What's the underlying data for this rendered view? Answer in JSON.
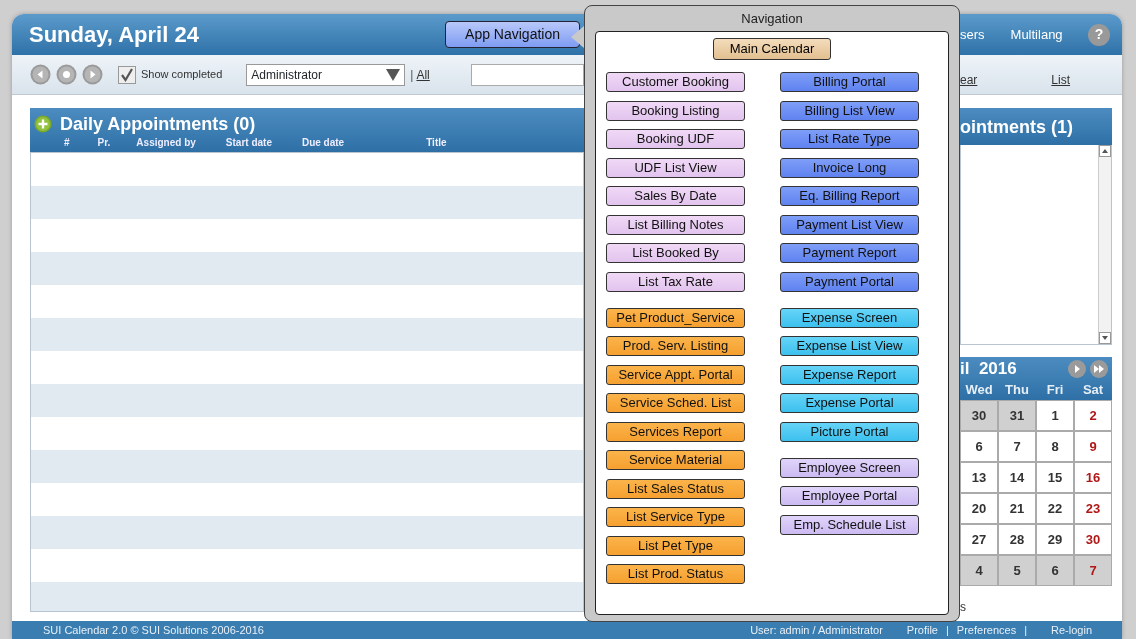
{
  "header": {
    "title": "Sunday, April 24",
    "nav_button": "App Navigation",
    "links": [
      "sers",
      "Multilang"
    ],
    "help": "?"
  },
  "toolbar": {
    "show_completed": {
      "label": "Show completed",
      "checked": true
    },
    "user_select": {
      "value": "Administrator"
    },
    "separator": "|",
    "all_link": "All",
    "view_links": [
      "ear",
      "List"
    ]
  },
  "daily_panel": {
    "title": "Daily Appointments (0)",
    "columns": [
      "#",
      "Pr.",
      "Assigned by",
      "Start date",
      "Due date",
      "Title"
    ]
  },
  "right_panel": {
    "title": "ointments (1)"
  },
  "calendar": {
    "title": "il  2016",
    "weekdays": [
      "Wed",
      "Thu",
      "Fri",
      "Sat"
    ],
    "weeks": [
      [
        {
          "day": "30",
          "other_month": true,
          "weekend": false
        },
        {
          "day": "31",
          "other_month": true,
          "weekend": false
        },
        {
          "day": "1",
          "other_month": false,
          "weekend": false
        },
        {
          "day": "2",
          "other_month": false,
          "weekend": true
        }
      ],
      [
        {
          "day": "6",
          "other_month": false,
          "weekend": false
        },
        {
          "day": "7",
          "other_month": false,
          "weekend": false
        },
        {
          "day": "8",
          "other_month": false,
          "weekend": false
        },
        {
          "day": "9",
          "other_month": false,
          "weekend": true
        }
      ],
      [
        {
          "day": "13",
          "other_month": false,
          "weekend": false
        },
        {
          "day": "14",
          "other_month": false,
          "weekend": false
        },
        {
          "day": "15",
          "other_month": false,
          "weekend": false
        },
        {
          "day": "16",
          "other_month": false,
          "weekend": true
        }
      ],
      [
        {
          "day": "20",
          "other_month": false,
          "weekend": false
        },
        {
          "day": "21",
          "other_month": false,
          "weekend": false
        },
        {
          "day": "22",
          "other_month": false,
          "weekend": false
        },
        {
          "day": "23",
          "other_month": false,
          "weekend": true
        }
      ],
      [
        {
          "day": "27",
          "other_month": false,
          "weekend": false
        },
        {
          "day": "28",
          "other_month": false,
          "weekend": false
        },
        {
          "day": "29",
          "other_month": false,
          "weekend": false
        },
        {
          "day": "30",
          "other_month": false,
          "weekend": true
        }
      ],
      [
        {
          "day": "4",
          "other_month": true,
          "weekend": false
        },
        {
          "day": "5",
          "other_month": true,
          "weekend": false
        },
        {
          "day": "6",
          "other_month": true,
          "weekend": false
        },
        {
          "day": "7",
          "other_month": true,
          "weekend": true
        }
      ]
    ],
    "below_text": "s"
  },
  "navigation": {
    "title": "Navigation",
    "main_button": "Main Calendar",
    "columns": [
      {
        "groups": [
          {
            "kind": "booking",
            "items": [
              "Customer Booking",
              "Booking Listing",
              "Booking UDF",
              "UDF List View",
              "Sales By Date",
              "List Billing Notes",
              "List Booked By",
              "List Tax Rate"
            ]
          },
          {
            "kind": "service",
            "items": [
              "Pet Product_Service",
              "Prod. Serv. Listing",
              "Service  Appt. Portal",
              "Service  Sched. List",
              "Services Report",
              "Service  Material",
              "List Sales Status",
              "List Service Type",
              "List Pet Type",
              "List Prod. Status"
            ]
          }
        ]
      },
      {
        "groups": [
          {
            "kind": "billing",
            "items": [
              "Billing Portal",
              "Billing List View",
              "List Rate Type",
              "Invoice Long",
              "Eq. Billing Report",
              "Payment List View",
              "Payment Report",
              "Payment Portal"
            ]
          },
          {
            "kind": "expense",
            "items": [
              "Expense Screen",
              "Expense List View",
              "Expense Report",
              "Expense Portal",
              "Picture Portal"
            ]
          },
          {
            "kind": "employee",
            "items": [
              "Employee Screen",
              "Employee Portal",
              "Emp. Schedule List"
            ]
          }
        ]
      }
    ]
  },
  "footer": {
    "copyright": "SUI Calendar 2.0 © SUI Solutions 2006-2016",
    "user": "User: admin / Administrator",
    "links": [
      "Profile",
      "Preferences",
      "Re-login"
    ],
    "separator": "|"
  }
}
